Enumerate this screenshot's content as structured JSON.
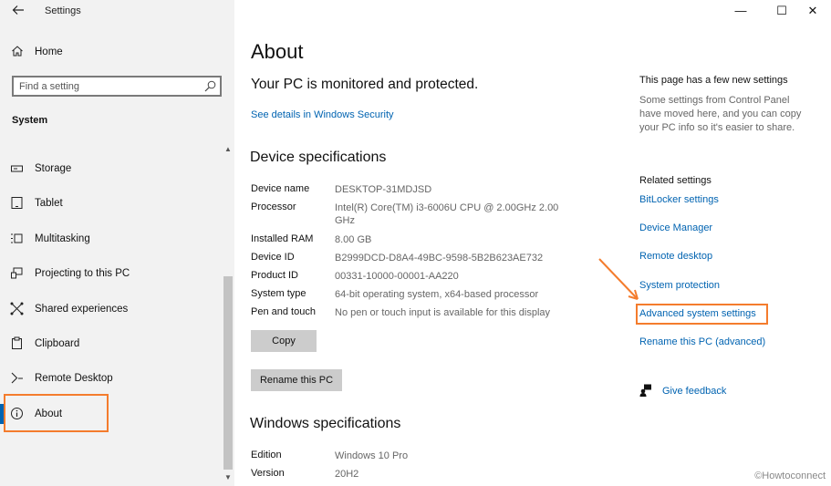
{
  "window": {
    "title": "Settings",
    "controls": {
      "minimize": "—",
      "maximize": "☐",
      "close": "✕"
    }
  },
  "sidebar": {
    "home_label": "Home",
    "search_placeholder": "Find a setting",
    "section": "System",
    "items": [
      {
        "label": "Storage",
        "icon": "storage-icon"
      },
      {
        "label": "Tablet",
        "icon": "tablet-icon"
      },
      {
        "label": "Multitasking",
        "icon": "multitasking-icon"
      },
      {
        "label": "Projecting to this PC",
        "icon": "projecting-icon"
      },
      {
        "label": "Shared experiences",
        "icon": "shared-experiences-icon"
      },
      {
        "label": "Clipboard",
        "icon": "clipboard-icon"
      },
      {
        "label": "Remote Desktop",
        "icon": "remote-desktop-icon"
      },
      {
        "label": "About",
        "icon": "info-icon",
        "active": true
      }
    ]
  },
  "main": {
    "title": "About",
    "protection_status": "Your PC is monitored and protected.",
    "security_link": "See details in Windows Security",
    "device_specs_heading": "Device specifications",
    "device_specs": [
      {
        "key": "Device name",
        "value": "DESKTOP-31MDJSD"
      },
      {
        "key": "Processor",
        "value": "Intel(R) Core(TM) i3-6006U CPU @ 2.00GHz   2.00 GHz"
      },
      {
        "key": "Installed RAM",
        "value": "8.00 GB"
      },
      {
        "key": "Device ID",
        "value": "B2999DCD-D8A4-49BC-9598-5B2B623AE732"
      },
      {
        "key": "Product ID",
        "value": "00331-10000-00001-AA220"
      },
      {
        "key": "System type",
        "value": "64-bit operating system, x64-based processor"
      },
      {
        "key": "Pen and touch",
        "value": "No pen or touch input is available for this display"
      }
    ],
    "copy_button": "Copy",
    "rename_button": "Rename this PC",
    "windows_specs_heading": "Windows specifications",
    "windows_specs": [
      {
        "key": "Edition",
        "value": "Windows 10 Pro"
      },
      {
        "key": "Version",
        "value": "20H2"
      }
    ]
  },
  "right_panel": {
    "new_settings_title": "This page has a few new settings",
    "new_settings_desc": "Some settings from Control Panel have moved here, and you can copy your PC info so it's easier to share.",
    "related_heading": "Related settings",
    "links": [
      "BitLocker settings",
      "Device Manager",
      "Remote desktop",
      "System protection",
      "Advanced system settings",
      "Rename this PC (advanced)"
    ],
    "feedback": "Give feedback"
  },
  "watermark": "©Howtoconnect",
  "colors": {
    "accent": "#0063b1",
    "highlight": "#f47c2d",
    "sidebar_bg": "#f2f2f2"
  }
}
